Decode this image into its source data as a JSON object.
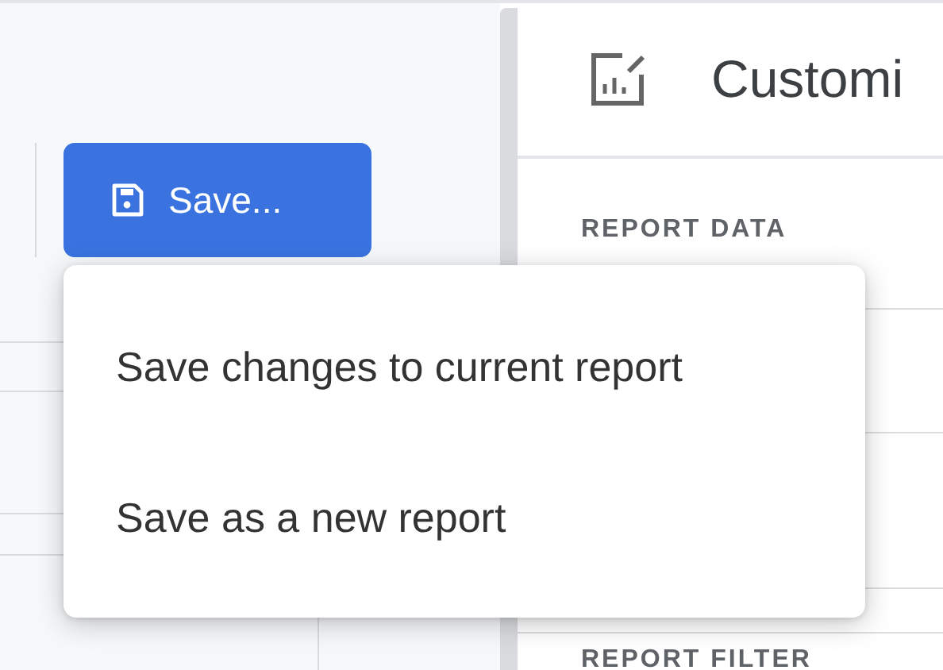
{
  "toolbar": {
    "save_button": {
      "label": "Save..."
    }
  },
  "save_menu": {
    "open": true,
    "items": [
      {
        "label": "Save changes to current report"
      },
      {
        "label": "Save as a new report"
      }
    ]
  },
  "customize_panel": {
    "title": "Customi",
    "sections": [
      {
        "heading": "REPORT DATA"
      },
      {
        "heading": "REPORT FILTER"
      }
    ]
  }
}
